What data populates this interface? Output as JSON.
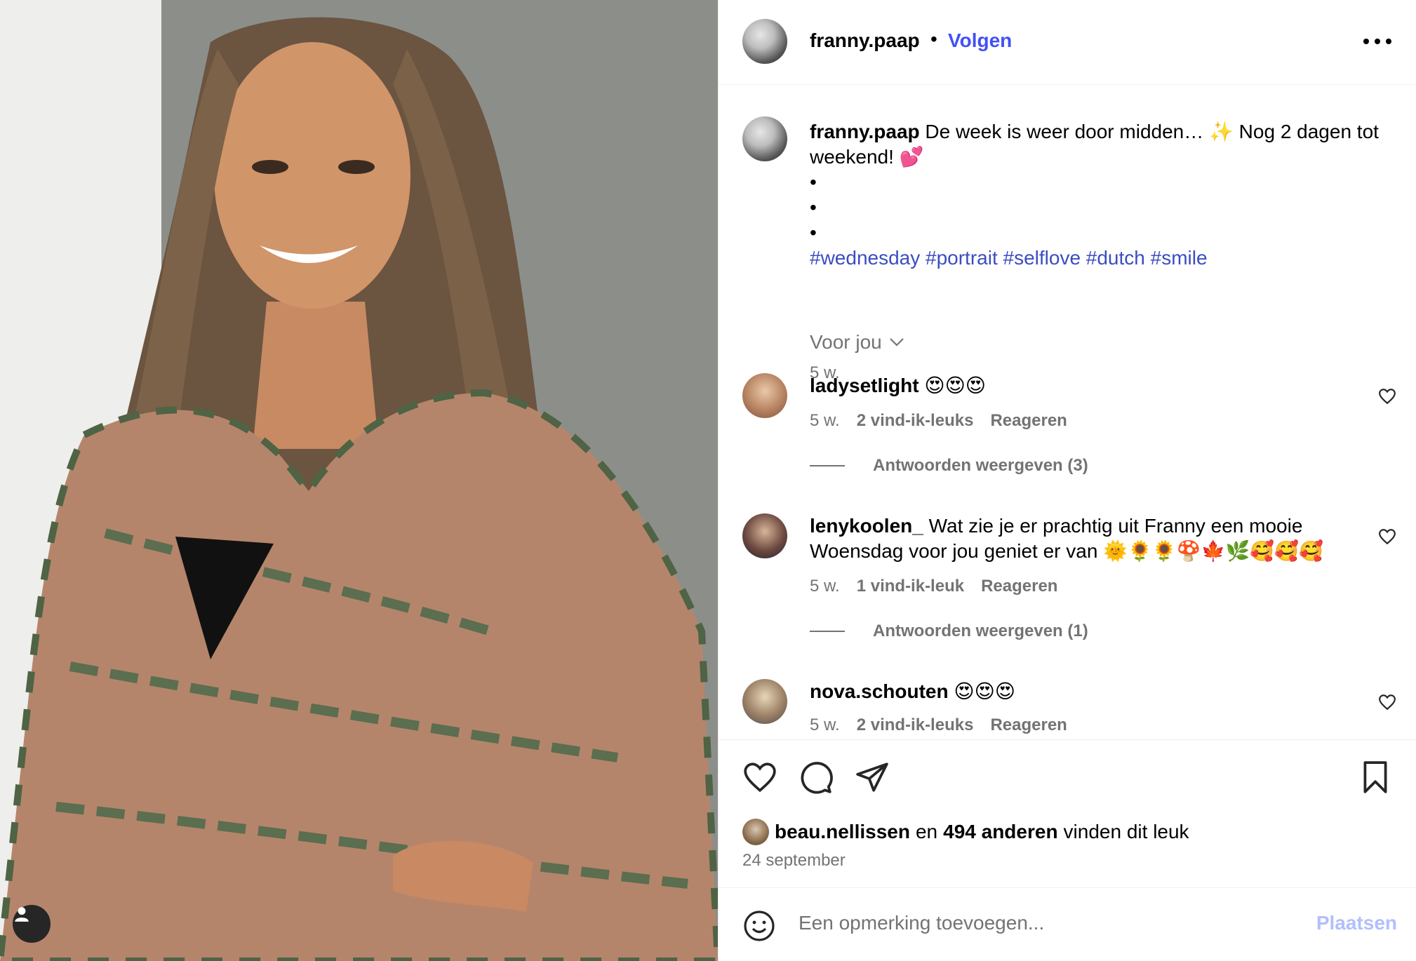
{
  "post": {
    "username": "franny.paap",
    "separator": "•",
    "follow_label": "Volgen",
    "more_icon": "more-horizontal-icon"
  },
  "caption": {
    "username": "franny.paap",
    "text_1": "De week is weer door midden… ✨ Nog 2 dagen tot weekend! 💕",
    "bullets": [
      "•",
      "•",
      "•"
    ],
    "hashtags": "#wednesday #portrait #selflove #dutch #smile",
    "time": "5 w."
  },
  "filter": {
    "label": "Voor jou",
    "icon": "chevron-down-icon"
  },
  "comments": [
    {
      "username": "ladysetlight",
      "text": "😍😍😍",
      "time": "5 w.",
      "likes": "2 vind-ik-leuks",
      "reply": "Reageren",
      "view_replies": "Antwoorden weergeven (3)"
    },
    {
      "username": "lenykoolen_",
      "text": "Wat zie je er prachtig uit Franny een mooie Woensdag voor jou geniet er van 🌞🌻🌻🍄🍁🌿🥰🥰🥰",
      "time": "5 w.",
      "likes": "1 vind-ik-leuk",
      "reply": "Reageren",
      "view_replies": "Antwoorden weergeven (1)"
    },
    {
      "username": "nova.schouten",
      "text": "😍😍😍",
      "time": "5 w.",
      "likes": "2 vind-ik-leuks",
      "reply": "Reageren"
    }
  ],
  "actions": {
    "icons": [
      "heart-icon",
      "comment-icon",
      "share-icon",
      "bookmark-icon"
    ]
  },
  "likes": {
    "user": "beau.nellissen",
    "connector": "en",
    "count": "494 anderen",
    "suffix": "vinden dit leuk"
  },
  "date": "24 september",
  "comment_box": {
    "placeholder": "Een opmerking toevoegen...",
    "post_label": "Plaatsen"
  },
  "colors": {
    "accent": "#4150f7",
    "hashtag": "#3b4dc1",
    "muted": "#737373",
    "post_disabled": "#b2bffc"
  }
}
